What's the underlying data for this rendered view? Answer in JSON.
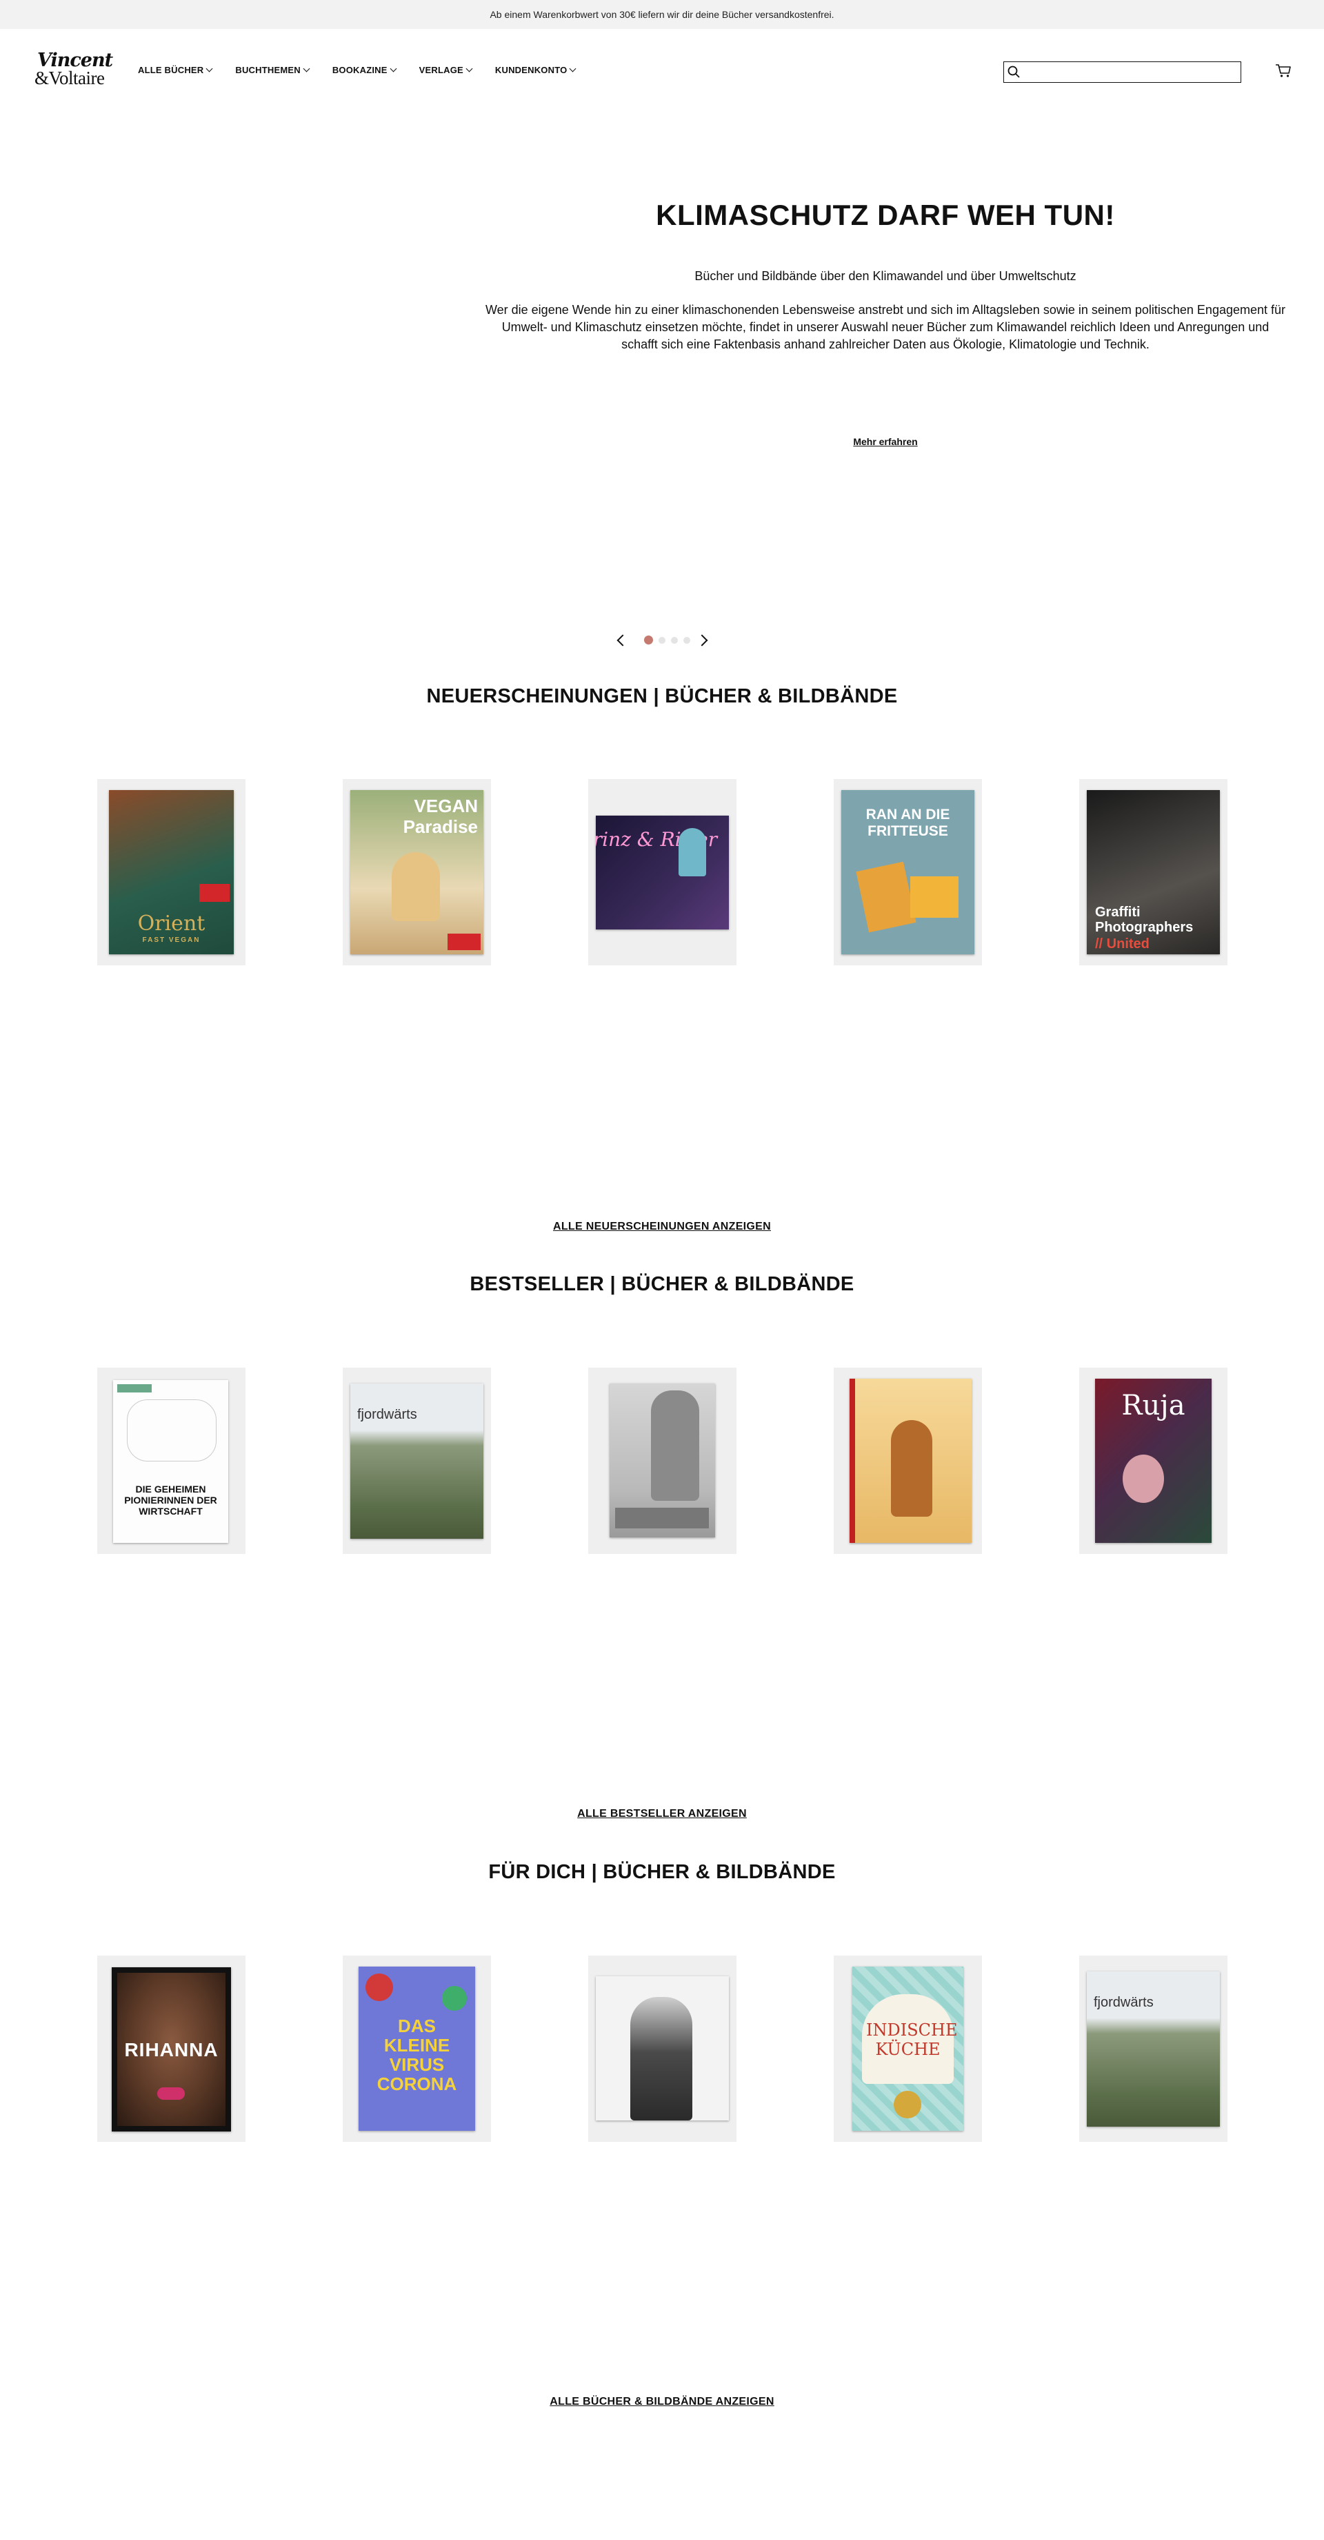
{
  "announcement": "Ab einem Warenkorbwert von 30€ liefern wir dir deine Bücher versandkostenfrei.",
  "brand": {
    "line1": "Vincent",
    "line2": "&Voltaire"
  },
  "nav": [
    {
      "label": "ALLE BÜCHER"
    },
    {
      "label": "BUCHTHEMEN"
    },
    {
      "label": "BOOKAZINE"
    },
    {
      "label": "VERLAGE"
    },
    {
      "label": "KUNDENKONTO"
    }
  ],
  "search": {
    "value": "",
    "placeholder": ""
  },
  "hero": {
    "title": "KLIMASCHUTZ DARF WEH TUN!",
    "subtitle": "Bücher und Bildbände über den Klimawandel und über Umweltschutz",
    "text": "Wer die eigene Wende hin zu einer klimaschonenden Lebensweise anstrebt und sich im Alltagsleben sowie in seinem politischen Engagement für Umwelt- und Klimaschutz einsetzen möchte, findet in unserer Auswahl neuer Bücher zum Klimawandel reichlich Ideen und Anregungen und schafft sich eine Faktenbasis anhand zahlreicher Daten aus Ökologie, Klimatologie und Technik.",
    "link": "Mehr erfahren",
    "slides_total": 4,
    "slide_active": 1
  },
  "sections": [
    {
      "title": "NEUERSCHEINUNGEN | BÜCHER & BILDBÄNDE",
      "link": "ALLE NEUERSCHEINUNGEN ANZEIGEN",
      "books": [
        {
          "cover_text": "Orient",
          "cover_sub": "FAST VEGAN",
          "colors": [
            "#2a5e4c",
            "#8a4b2a"
          ],
          "accent": "#d4b15a"
        },
        {
          "cover_text": "VEGAN Paradise",
          "colors": [
            "#9bb07a",
            "#e9d9b4"
          ],
          "accent": "#ffffff"
        },
        {
          "cover_text": "Prinz & Ritter",
          "colors": [
            "#1c1637",
            "#5a3a7a"
          ],
          "accent": "#ff9ad5"
        },
        {
          "cover_text": "RAN AN DIE FRITTEUSE",
          "colors": [
            "#6f95a0",
            "#7ea4ae"
          ],
          "accent": "#ffffff"
        },
        {
          "cover_text": "Graffiti Photographers",
          "cover_sub": "// United",
          "colors": [
            "#1a1a1a",
            "#55524e"
          ],
          "accent": "#ffffff"
        }
      ]
    },
    {
      "title": "BESTSELLER | BÜCHER & BILDBÄNDE",
      "link": "ALLE BESTSELLER ANZEIGEN",
      "books": [
        {
          "cover_text": "DIE GEHEIMEN PIONIERINNEN DER WIRTSCHAFT",
          "colors": [
            "#ffffff",
            "#f4f4f4"
          ],
          "accent": "#111111"
        },
        {
          "cover_text": "fjordwärts",
          "colors": [
            "#e9ecef",
            "#5b6e4a"
          ],
          "accent": "#333333"
        },
        {
          "cover_text": "",
          "colors": [
            "#d6d6d6",
            "#9a9a9a"
          ],
          "accent": "#333333"
        },
        {
          "cover_text": "",
          "colors": [
            "#f7d99a",
            "#e7b865"
          ],
          "accent": "#c02020"
        },
        {
          "cover_text": "Ruja",
          "colors": [
            "#7a1a2a",
            "#2a4a3a"
          ],
          "accent": "#ffffff"
        }
      ]
    },
    {
      "title": "FÜR DICH | BÜCHER & BILDBÄNDE",
      "link": "ALLE BÜCHER & BILDBÄNDE ANZEIGEN",
      "books": [
        {
          "cover_text": "RIHANNA",
          "colors": [
            "#3b2418",
            "#6a4430"
          ],
          "accent": "#ffffff"
        },
        {
          "cover_text": "DAS KLEINE VIRUS CORONA",
          "colors": [
            "#6f78d6",
            "#5a64c8"
          ],
          "accent": "#f5d23a"
        },
        {
          "cover_text": "",
          "colors": [
            "#f3f3f3",
            "#5a5a5a"
          ],
          "accent": "#222222"
        },
        {
          "cover_text": "INDISCHE KÜCHE",
          "colors": [
            "#9ad4cf",
            "#c4e6e2"
          ],
          "accent": "#c0392b"
        },
        {
          "cover_text": "fjordwärts",
          "colors": [
            "#e9ecef",
            "#5b6e4a"
          ],
          "accent": "#333333"
        }
      ]
    }
  ]
}
